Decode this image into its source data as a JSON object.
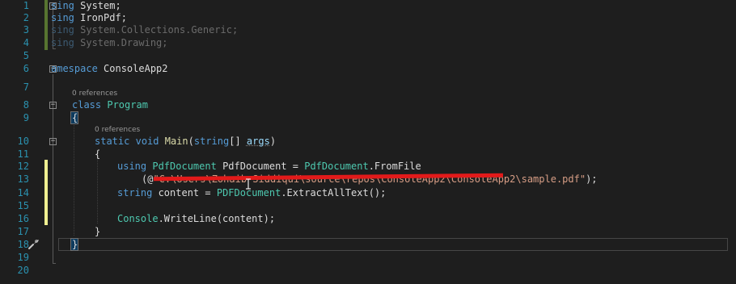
{
  "editor": {
    "line_numbers": [
      "1",
      "2",
      "3",
      "4",
      "5",
      "6",
      "7",
      "8",
      "9",
      "10",
      "11",
      "12",
      "13",
      "14",
      "15",
      "16",
      "17",
      "18",
      "19",
      "20"
    ],
    "codelens_class": "0 references",
    "codelens_main": "0 references",
    "lines": {
      "l1_kw": "sing",
      "l1_rest": " System;",
      "l2_kw": "sing",
      "l2_rest": " IronPdf;",
      "l3_kw": "sing",
      "l3_rest": " System.Collections.Generic;",
      "l4_kw": "sing",
      "l4_rest": " System.Drawing;",
      "l6_kw": "amespace",
      "l6_rest": " ConsoleApp2",
      "l8_kw": "class",
      "l8_cls": "Program",
      "l9": "{",
      "l10_static": "static",
      "l10_void": "void",
      "l10_name": "Main",
      "l10_open": "(",
      "l10_type": "string",
      "l10_arr": "[] ",
      "l10_param": "args",
      "l10_close": ")",
      "l11": "{",
      "l12_using": "using",
      "l12_type": "PdfDocument",
      "l12_var": " PdfDocument = ",
      "l12_cls": "PdfDocument",
      "l12_call": ".FromFile",
      "l13_open": "(@",
      "l13_str": "\"C:\\Users\\Zohaib Siddiqui\\source\\repos\\ConsoleApp2\\ConsoleApp2\\sample.pdf\"",
      "l13_close": ");",
      "l14_type": "string",
      "l14_rest": " content = ",
      "l14_cls": "PDFDocument",
      "l14_call": ".ExtractAllText();",
      "l16_cls": "Console",
      "l16_call": ".WriteLine(content);",
      "l17": "}",
      "l18": "}"
    }
  },
  "colors": {
    "background": "#1e1e1e",
    "line_number": "#2b91af",
    "keyword": "#569cd6",
    "type": "#4ec9b0",
    "string": "#d69d85",
    "method": "#dcdcaa",
    "change_saved": "#577430",
    "change_unsaved": "#efef91",
    "redaction": "#e21a1a"
  },
  "icons": {
    "quick_action": "screwdriver-icon",
    "fold_collapse": "fold-minus-icon"
  }
}
